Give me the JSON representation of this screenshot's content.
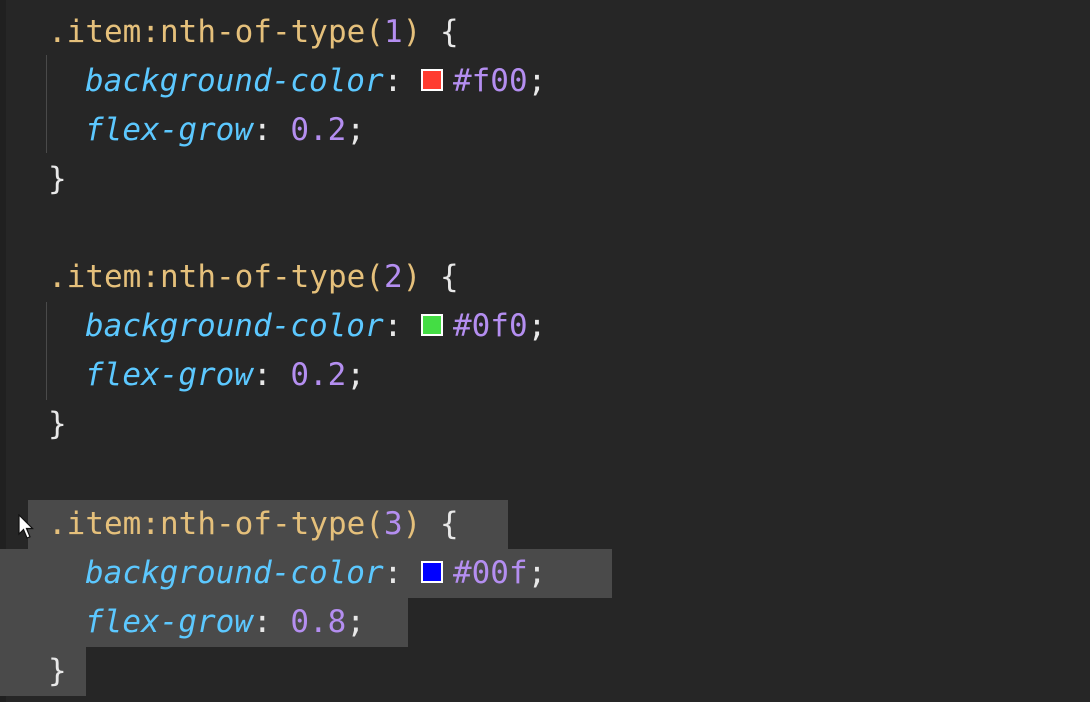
{
  "rules": [
    {
      "selector": ".item",
      "pseudo": ":nth-of-type(",
      "index": "1",
      "close_paren": ")",
      "open_brace": " {",
      "decls": [
        {
          "prop": "background-color",
          "colon": ":",
          "swatch": "#ff3b2f",
          "value": "#f00",
          "semi": ";"
        },
        {
          "prop": "flex-grow",
          "colon": ":",
          "value": "0.2",
          "semi": ";"
        }
      ],
      "close_brace": "}"
    },
    {
      "selector": ".item",
      "pseudo": ":nth-of-type(",
      "index": "2",
      "close_paren": ")",
      "open_brace": " {",
      "decls": [
        {
          "prop": "background-color",
          "colon": ":",
          "swatch": "#44dd44",
          "value": "#0f0",
          "semi": ";"
        },
        {
          "prop": "flex-grow",
          "colon": ":",
          "value": "0.2",
          "semi": ";"
        }
      ],
      "close_brace": "}"
    },
    {
      "selector": ".item",
      "pseudo": ":nth-of-type(",
      "index": "3",
      "close_paren": ")",
      "open_brace": " {",
      "decls": [
        {
          "prop": "background-color",
          "colon": ":",
          "swatch": "#0000ff",
          "value": "#00f",
          "semi": ";"
        },
        {
          "prop": "flex-grow",
          "colon": ":",
          "value": "0.8",
          "semi": ";"
        }
      ],
      "close_brace": "}"
    }
  ],
  "colors": {
    "background": "#262626",
    "selection": "#4a4a4a",
    "selector": "#e5c07b",
    "property": "#5cc8ff",
    "number": "#b48ef0"
  }
}
